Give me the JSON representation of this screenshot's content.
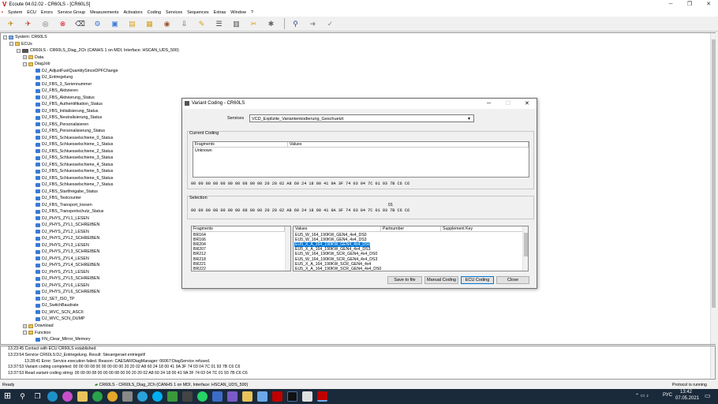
{
  "window": {
    "title": "Ecoute 04.02.02 - CR60LS - [CR60LS]"
  },
  "menu": [
    "System",
    "ECU",
    "Errors",
    "Service Group",
    "Measurements",
    "Activators",
    "Coding",
    "Services",
    "Sequences",
    "Extras",
    "Window",
    "?"
  ],
  "tree": {
    "system": "System: CR60LS",
    "ecus": "ECUs",
    "ecu": "CR60LS - CR60LS_Diag_2Ch (CANHS 1 on MDI, Interface: HSCAN_UDS_500)",
    "data": "Data",
    "diagjob": "DiagJob",
    "jobs": [
      "DJ_AdjustFuelQuantitySinceDPFChange",
      "DJ_Entriegelung",
      "DJ_FBS_3_Seriennummer",
      "DJ_FBS_Aktivieren",
      "DJ_FBS_Aktivierung_Status",
      "DJ_FBS_Authentifikation_Status",
      "DJ_FBS_Initialisierung_Status",
      "DJ_FBS_Neutralisierung_Status",
      "DJ_FBS_Personalisieren",
      "DJ_FBS_Personalisierung_Status",
      "DJ_FBS_Schluesselschiene_0_Status",
      "DJ_FBS_Schluesselschiene_1_Status",
      "DJ_FBS_Schluesselschiene_2_Status",
      "DJ_FBS_Schluesselschiene_3_Status",
      "DJ_FBS_Schluesselschiene_4_Status",
      "DJ_FBS_Schluesselschiene_5_Status",
      "DJ_FBS_Schluesselschiene_6_Status",
      "DJ_FBS_Schluesselschiene_7_Status",
      "DJ_FBS_Startfreigabe_Status",
      "DJ_FBS_Testcounter",
      "DJ_FBS_Transport_loesen",
      "DJ_FBS_Transportschutz_Status",
      "DJ_PHYS_ZYL1_LESEN",
      "DJ_PHYS_ZYL1_SCHREIBEN",
      "DJ_PHYS_ZYL2_LESEN",
      "DJ_PHYS_ZYL2_SCHREIBEN",
      "DJ_PHYS_ZYL3_LESEN",
      "DJ_PHYS_ZYL3_SCHREIBEN",
      "DJ_PHYS_ZYL4_LESEN",
      "DJ_PHYS_ZYL4_SCHREIBEN",
      "DJ_PHYS_ZYL5_LESEN",
      "DJ_PHYS_ZYL5_SCHREIBEN",
      "DJ_PHYS_ZYL6_LESEN",
      "DJ_PHYS_ZYL6_SCHREIBEN",
      "DJ_SET_ISO_TP",
      "DJ_SwitchBaudrate",
      "DJ_WVC_SCN_ASCII",
      "DJ_WVC_SCN_DUMP"
    ],
    "download": "Download",
    "function": "Function",
    "fn_clear": "FN_Clear_Mirror_Memory"
  },
  "log": [
    "13:23:45 Contact with ECU CR60LS established.",
    "13:23:54 Service CR60LS:DJ_Entriegelung. Result: Steuergeraet entriegelt!",
    "13:28:41 Error: Service execution failed. Reason:  CAESAR/DiagManager: 06067:DiagService refused.",
    "13:37:53 Variant coding completed: 00 00 00 08 00 00 00 00 00 20 20 02 A8 60 24 18 00 41 9A 3F 74 03 04 7C 01 93 7B C6 C6",
    "13:37:53 Read variant coding string: 00 00 00 08 00 00 00 08 00 00 20 20 02 A8 60 24 18 00 41 9A 3F 74 03 04 7C 01 93 7B C6 C6"
  ],
  "status": {
    "left": "Ready",
    "middle": "CR60LS - CR60LS_Diag_2Ch (CANHS 1 on MDI, Interface: HSCAN_UDS_500)",
    "right": "Protocol is running"
  },
  "taskbar": {
    "lang": "РУС",
    "time": "13:42",
    "date": "07.05.2021"
  },
  "dialog": {
    "title": "Variant Coding - CR60LS",
    "services_label": "Services",
    "services_value": "VCD_Explizite_Variantenkodierung_Geschuetzt",
    "current_coding": "Current Coding",
    "col_fragments": "Fragments",
    "col_values": "Values",
    "current_fragment": "Unknown",
    "current_hex": "00 00 00 08 00 00 00 08 00 00 20 20 02 A8 60 24 18 00 41 9A 3F 74 03 04 7C 01 93 7B C6 C6",
    "selection": "Selection",
    "sel_marker": "01",
    "selection_hex": "00 00 00 08 00 00 00 08 00 00 20 20 02 A8 60 24 18 00 41 9A 3F 74 03 04 7C 01 93 7B C6 C6",
    "frag_header": "Fragments",
    "values_header": "Values",
    "partnumber_header": "Partnumber",
    "supplement_header": "Supplement Key",
    "fragments": [
      "BR164",
      "BR166",
      "BR204",
      "BR207",
      "BR212",
      "BR218",
      "BR221",
      "BR222"
    ],
    "values": [
      "EU5_W_164_190KW_GEN4_4x4_DS0",
      "EU5_W_164_190KW_GEN4_4x4_DS3",
      "EU5_X_A_164_190KW_GEN4_4x4_DS0",
      "EU5_X_A_164_190KW_GEN4_4x4_DS3",
      "EU5_W_164_190KW_SCR_GEN4_4x4_DS0",
      "EU5_W_164_190KW_SCR_GEN4_4x4_DS3",
      "EU5_X_A_164_190KW_SCR_GEN4_4x4",
      "EU5_X_A_164_190KW_SCR_GEN4_4x4_DS0"
    ],
    "selected_value_index": 2,
    "btn_save": "Save to file",
    "btn_manual": "Manual Coding",
    "btn_ecu": "ECU Coding",
    "btn_close": "Close"
  }
}
